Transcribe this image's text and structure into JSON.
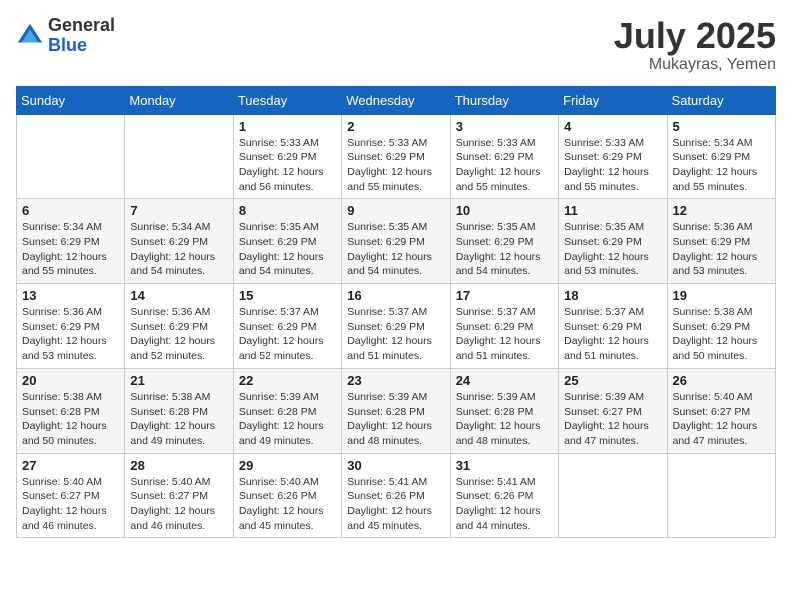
{
  "header": {
    "logo_general": "General",
    "logo_blue": "Blue",
    "title": "July 2025",
    "location": "Mukayras, Yemen"
  },
  "weekdays": [
    "Sunday",
    "Monday",
    "Tuesday",
    "Wednesday",
    "Thursday",
    "Friday",
    "Saturday"
  ],
  "weeks": [
    [
      {
        "day": "",
        "sunrise": "",
        "sunset": "",
        "daylight": ""
      },
      {
        "day": "",
        "sunrise": "",
        "sunset": "",
        "daylight": ""
      },
      {
        "day": "1",
        "sunrise": "Sunrise: 5:33 AM",
        "sunset": "Sunset: 6:29 PM",
        "daylight": "Daylight: 12 hours and 56 minutes."
      },
      {
        "day": "2",
        "sunrise": "Sunrise: 5:33 AM",
        "sunset": "Sunset: 6:29 PM",
        "daylight": "Daylight: 12 hours and 55 minutes."
      },
      {
        "day": "3",
        "sunrise": "Sunrise: 5:33 AM",
        "sunset": "Sunset: 6:29 PM",
        "daylight": "Daylight: 12 hours and 55 minutes."
      },
      {
        "day": "4",
        "sunrise": "Sunrise: 5:33 AM",
        "sunset": "Sunset: 6:29 PM",
        "daylight": "Daylight: 12 hours and 55 minutes."
      },
      {
        "day": "5",
        "sunrise": "Sunrise: 5:34 AM",
        "sunset": "Sunset: 6:29 PM",
        "daylight": "Daylight: 12 hours and 55 minutes."
      }
    ],
    [
      {
        "day": "6",
        "sunrise": "Sunrise: 5:34 AM",
        "sunset": "Sunset: 6:29 PM",
        "daylight": "Daylight: 12 hours and 55 minutes."
      },
      {
        "day": "7",
        "sunrise": "Sunrise: 5:34 AM",
        "sunset": "Sunset: 6:29 PM",
        "daylight": "Daylight: 12 hours and 54 minutes."
      },
      {
        "day": "8",
        "sunrise": "Sunrise: 5:35 AM",
        "sunset": "Sunset: 6:29 PM",
        "daylight": "Daylight: 12 hours and 54 minutes."
      },
      {
        "day": "9",
        "sunrise": "Sunrise: 5:35 AM",
        "sunset": "Sunset: 6:29 PM",
        "daylight": "Daylight: 12 hours and 54 minutes."
      },
      {
        "day": "10",
        "sunrise": "Sunrise: 5:35 AM",
        "sunset": "Sunset: 6:29 PM",
        "daylight": "Daylight: 12 hours and 54 minutes."
      },
      {
        "day": "11",
        "sunrise": "Sunrise: 5:35 AM",
        "sunset": "Sunset: 6:29 PM",
        "daylight": "Daylight: 12 hours and 53 minutes."
      },
      {
        "day": "12",
        "sunrise": "Sunrise: 5:36 AM",
        "sunset": "Sunset: 6:29 PM",
        "daylight": "Daylight: 12 hours and 53 minutes."
      }
    ],
    [
      {
        "day": "13",
        "sunrise": "Sunrise: 5:36 AM",
        "sunset": "Sunset: 6:29 PM",
        "daylight": "Daylight: 12 hours and 53 minutes."
      },
      {
        "day": "14",
        "sunrise": "Sunrise: 5:36 AM",
        "sunset": "Sunset: 6:29 PM",
        "daylight": "Daylight: 12 hours and 52 minutes."
      },
      {
        "day": "15",
        "sunrise": "Sunrise: 5:37 AM",
        "sunset": "Sunset: 6:29 PM",
        "daylight": "Daylight: 12 hours and 52 minutes."
      },
      {
        "day": "16",
        "sunrise": "Sunrise: 5:37 AM",
        "sunset": "Sunset: 6:29 PM",
        "daylight": "Daylight: 12 hours and 51 minutes."
      },
      {
        "day": "17",
        "sunrise": "Sunrise: 5:37 AM",
        "sunset": "Sunset: 6:29 PM",
        "daylight": "Daylight: 12 hours and 51 minutes."
      },
      {
        "day": "18",
        "sunrise": "Sunrise: 5:37 AM",
        "sunset": "Sunset: 6:29 PM",
        "daylight": "Daylight: 12 hours and 51 minutes."
      },
      {
        "day": "19",
        "sunrise": "Sunrise: 5:38 AM",
        "sunset": "Sunset: 6:29 PM",
        "daylight": "Daylight: 12 hours and 50 minutes."
      }
    ],
    [
      {
        "day": "20",
        "sunrise": "Sunrise: 5:38 AM",
        "sunset": "Sunset: 6:28 PM",
        "daylight": "Daylight: 12 hours and 50 minutes."
      },
      {
        "day": "21",
        "sunrise": "Sunrise: 5:38 AM",
        "sunset": "Sunset: 6:28 PM",
        "daylight": "Daylight: 12 hours and 49 minutes."
      },
      {
        "day": "22",
        "sunrise": "Sunrise: 5:39 AM",
        "sunset": "Sunset: 6:28 PM",
        "daylight": "Daylight: 12 hours and 49 minutes."
      },
      {
        "day": "23",
        "sunrise": "Sunrise: 5:39 AM",
        "sunset": "Sunset: 6:28 PM",
        "daylight": "Daylight: 12 hours and 48 minutes."
      },
      {
        "day": "24",
        "sunrise": "Sunrise: 5:39 AM",
        "sunset": "Sunset: 6:28 PM",
        "daylight": "Daylight: 12 hours and 48 minutes."
      },
      {
        "day": "25",
        "sunrise": "Sunrise: 5:39 AM",
        "sunset": "Sunset: 6:27 PM",
        "daylight": "Daylight: 12 hours and 47 minutes."
      },
      {
        "day": "26",
        "sunrise": "Sunrise: 5:40 AM",
        "sunset": "Sunset: 6:27 PM",
        "daylight": "Daylight: 12 hours and 47 minutes."
      }
    ],
    [
      {
        "day": "27",
        "sunrise": "Sunrise: 5:40 AM",
        "sunset": "Sunset: 6:27 PM",
        "daylight": "Daylight: 12 hours and 46 minutes."
      },
      {
        "day": "28",
        "sunrise": "Sunrise: 5:40 AM",
        "sunset": "Sunset: 6:27 PM",
        "daylight": "Daylight: 12 hours and 46 minutes."
      },
      {
        "day": "29",
        "sunrise": "Sunrise: 5:40 AM",
        "sunset": "Sunset: 6:26 PM",
        "daylight": "Daylight: 12 hours and 45 minutes."
      },
      {
        "day": "30",
        "sunrise": "Sunrise: 5:41 AM",
        "sunset": "Sunset: 6:26 PM",
        "daylight": "Daylight: 12 hours and 45 minutes."
      },
      {
        "day": "31",
        "sunrise": "Sunrise: 5:41 AM",
        "sunset": "Sunset: 6:26 PM",
        "daylight": "Daylight: 12 hours and 44 minutes."
      },
      {
        "day": "",
        "sunrise": "",
        "sunset": "",
        "daylight": ""
      },
      {
        "day": "",
        "sunrise": "",
        "sunset": "",
        "daylight": ""
      }
    ]
  ]
}
